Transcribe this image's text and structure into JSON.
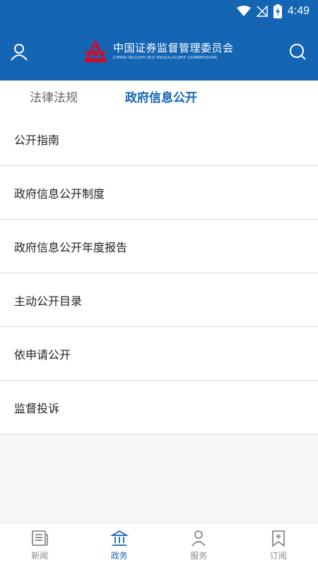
{
  "status_bar": {
    "time": "4:49"
  },
  "header": {
    "org_name_cn": "中国证券监督管理委员会",
    "org_name_en": "CHINA SECURITIES REGULATORY COMMISSION"
  },
  "tabs": [
    {
      "label": "法律法规",
      "active": false
    },
    {
      "label": "政府信息公开",
      "active": true
    }
  ],
  "list": [
    {
      "label": "公开指南"
    },
    {
      "label": "政府信息公开制度"
    },
    {
      "label": "政府信息公开年度报告"
    },
    {
      "label": "主动公开目录"
    },
    {
      "label": "依申请公开"
    },
    {
      "label": "监督投诉"
    }
  ],
  "bottom_nav": [
    {
      "label": "新闻",
      "icon": "newspaper-icon",
      "active": false
    },
    {
      "label": "政务",
      "icon": "government-building-icon",
      "active": true
    },
    {
      "label": "服务",
      "icon": "service-person-icon",
      "active": false
    },
    {
      "label": "订阅",
      "icon": "bookmark-add-icon",
      "active": false
    }
  ],
  "colors": {
    "brand_blue": "#1565b5",
    "logo_red": "#c8102e",
    "inactive_gray": "#8a8a8a"
  }
}
